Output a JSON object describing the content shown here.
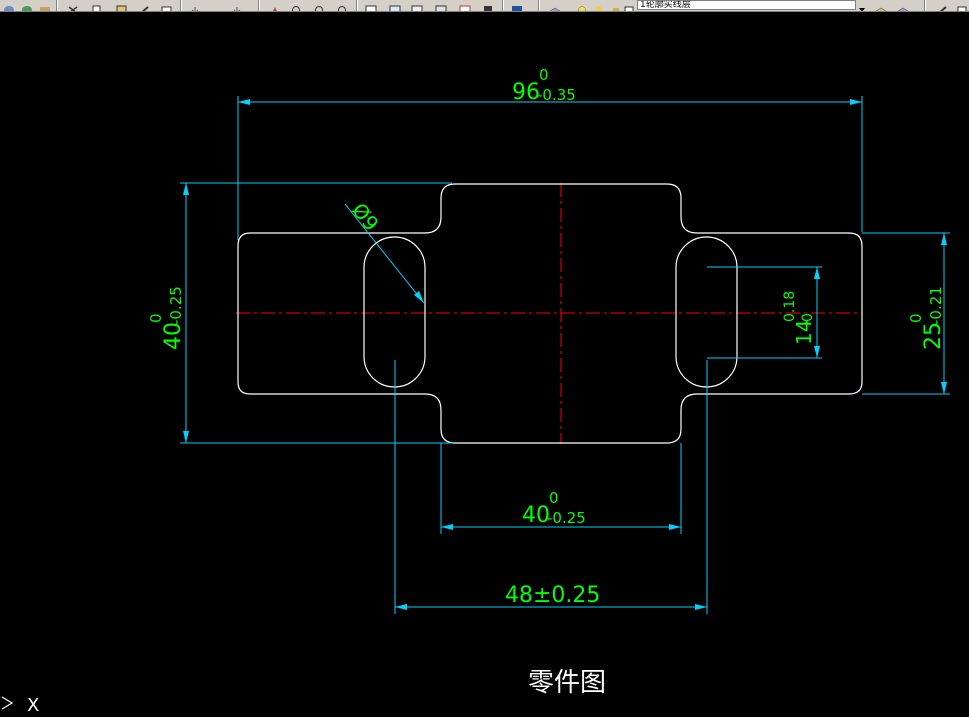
{
  "toolbar": {
    "layer_name": "1轮廓实线层"
  },
  "drawing": {
    "title": "零件图",
    "dim_overall_width": {
      "nominal": "96",
      "upper": "0",
      "lower": "-0.35"
    },
    "dim_height": {
      "nominal": "40",
      "upper": "0",
      "lower": "-0.25"
    },
    "dim_center_width": {
      "nominal": "40",
      "upper": "0",
      "lower": "-0.25"
    },
    "dim_slot_spacing": {
      "text": "48±0.25"
    },
    "dim_side_height": {
      "nominal": "25",
      "upper": "0",
      "lower": "-0.21"
    },
    "dim_slot_length": {
      "nominal": "14",
      "upper": "0.18",
      "lower": "0"
    },
    "dim_slot_width": {
      "text": "Ø9"
    }
  },
  "ucs": {
    "axis_label": "X"
  },
  "colors": {
    "background": "#000000",
    "outline": "#ffffff",
    "centerline": "#ff0000",
    "dimension_line": "#00d2ff",
    "dimension_text": "#00ff00"
  }
}
